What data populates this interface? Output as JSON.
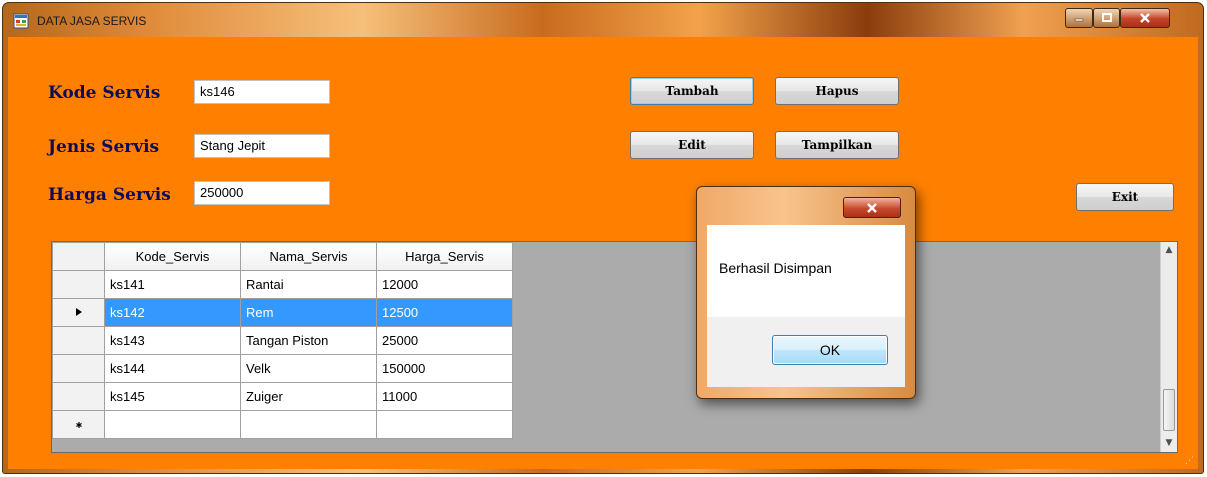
{
  "window": {
    "title": "DATA JASA SERVIS"
  },
  "form": {
    "kode_label": "Kode Servis",
    "kode_value": "ks146",
    "jenis_label": "Jenis Servis",
    "jenis_value": "Stang Jepit",
    "harga_label": "Harga Servis",
    "harga_value": "250000"
  },
  "buttons": {
    "tambah": "Tambah",
    "hapus": "Hapus",
    "edit": "Edit",
    "tampilkan": "Tampilkan",
    "exit": "Exit"
  },
  "grid": {
    "columns": [
      "Kode_Servis",
      "Nama_Servis",
      "Harga_Servis"
    ],
    "rows": [
      [
        "ks141",
        "Rantai",
        "12000"
      ],
      [
        "ks142",
        "Rem",
        "12500"
      ],
      [
        "ks143",
        "Tangan Piston",
        "25000"
      ],
      [
        "ks144",
        "Velk",
        "150000"
      ],
      [
        "ks145",
        "Zuiger",
        "11000"
      ]
    ],
    "selected_row": 1
  },
  "messagebox": {
    "text": "Berhasil Disimpan",
    "ok_label": "OK"
  },
  "colors": {
    "client_bg": "#ff8000",
    "label_color": "#0b0b5a",
    "selection": "#3399ff"
  }
}
